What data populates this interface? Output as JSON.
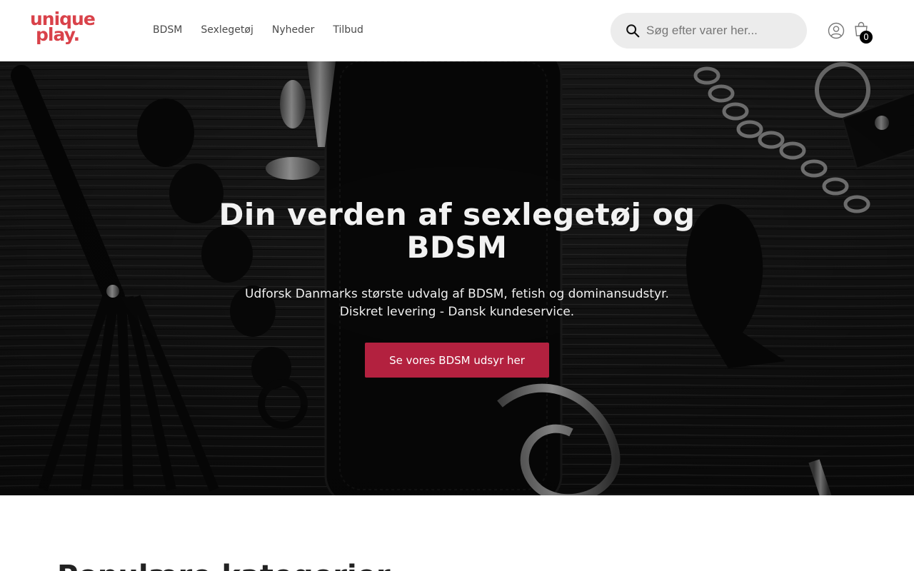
{
  "header": {
    "logo_line1": "unique",
    "logo_line2": "play.",
    "nav": [
      {
        "label": "BDSM"
      },
      {
        "label": "Sexlegetøj"
      },
      {
        "label": "Nyheder"
      },
      {
        "label": "Tilbud"
      }
    ],
    "search": {
      "placeholder": "Søg efter varer her...",
      "value": ""
    },
    "cart_count": "0"
  },
  "hero": {
    "title": "Din verden af sexlegetøj og BDSM",
    "subtitle_line1": "Udforsk Danmarks største udvalg af BDSM, fetish og dominansudstyr.",
    "subtitle_line2": "Diskret levering - Dansk kundeservice.",
    "cta_label": "Se vores BDSM udsyr her"
  },
  "section": {
    "title": "Populære kategorier"
  },
  "colors": {
    "brand": "#d9424a",
    "cta": "#b3213f",
    "search_bg": "#ececec"
  },
  "icons": [
    "search-icon",
    "user-icon",
    "cart-icon"
  ]
}
